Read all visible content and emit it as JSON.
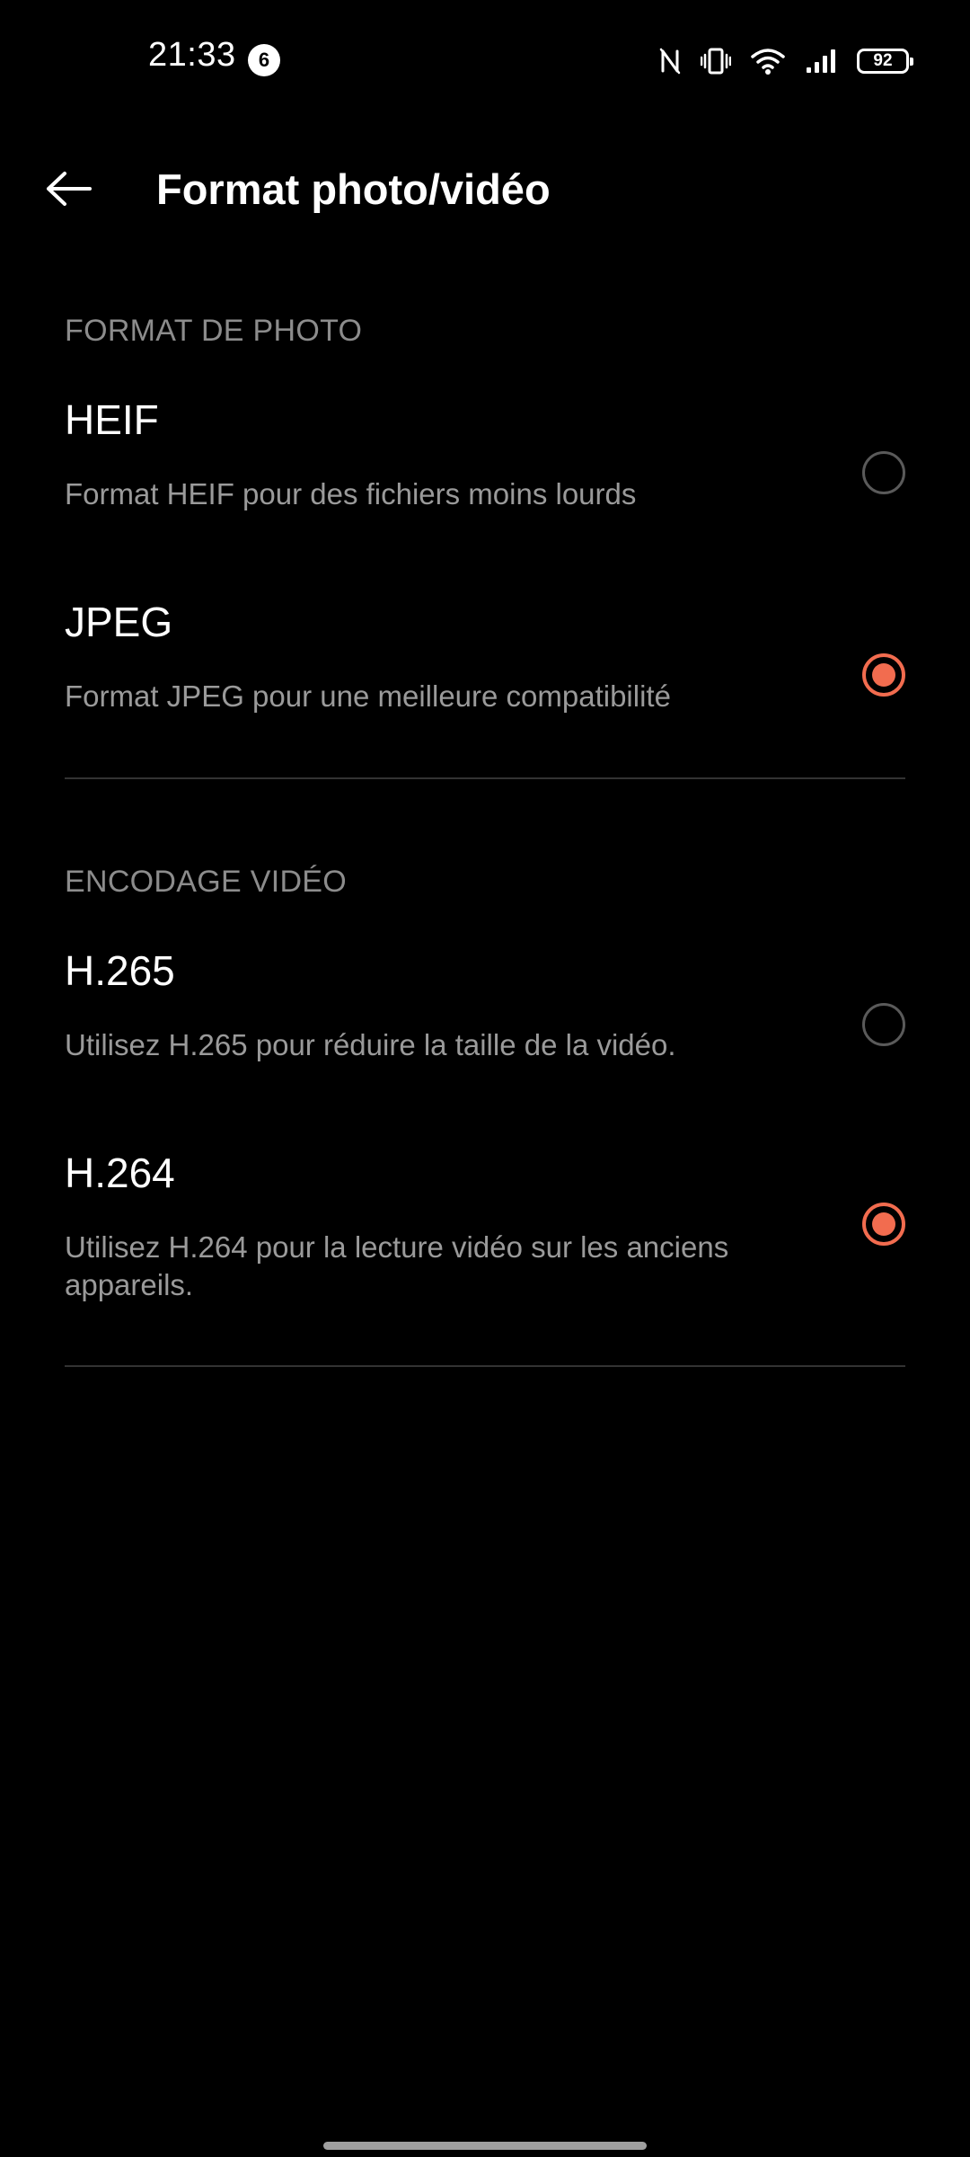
{
  "status_bar": {
    "time": "21:33",
    "notification_count": "6",
    "battery_level": "92",
    "icons": [
      "nfc-icon",
      "vibrate-icon",
      "wifi-icon",
      "signal-icon",
      "battery-icon"
    ]
  },
  "header": {
    "title": "Format photo/vidéo",
    "back_icon": "back-arrow-icon"
  },
  "photo_format": {
    "label": "FORMAT DE PHOTO",
    "options": [
      {
        "title": "HEIF",
        "description": "Format HEIF pour des fichiers moins lourds",
        "selected": false
      },
      {
        "title": "JPEG",
        "description": "Format JPEG pour une meilleure compatibilité",
        "selected": true
      }
    ]
  },
  "video_encoding": {
    "label": "ENCODAGE VIDÉO",
    "options": [
      {
        "title": "H.265",
        "description": "Utilisez H.265 pour réduire la taille de la vidéo.",
        "selected": false
      },
      {
        "title": "H.264",
        "description": "Utilisez H.264 pour la lecture vidéo sur les anciens appareils.",
        "selected": true
      }
    ]
  },
  "colors": {
    "background": "#000000",
    "accent": "#f26c4f",
    "secondary_text": "#9a9a9a",
    "section_label": "#8c8c8c"
  }
}
